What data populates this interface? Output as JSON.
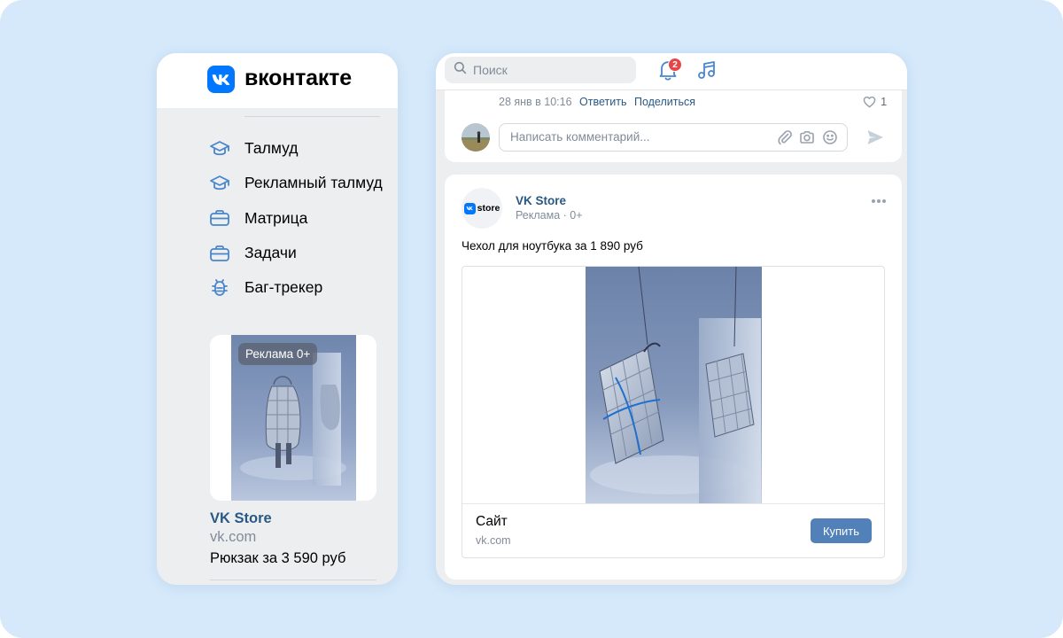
{
  "brand": {
    "logo_text": "вконтакте",
    "accent_color": "#0077ff",
    "link_color": "#2a5885",
    "background_color": "#d5e9fb"
  },
  "sidebar": {
    "items": [
      {
        "label": "Талмуд",
        "icon": "graduation-cap-icon"
      },
      {
        "label": "Рекламный талмуд",
        "icon": "graduation-cap-icon"
      },
      {
        "label": "Матрица",
        "icon": "briefcase-icon"
      },
      {
        "label": "Задачи",
        "icon": "briefcase-icon"
      },
      {
        "label": "Баг-трекер",
        "icon": "bug-icon"
      }
    ],
    "ad": {
      "badge": "Реклама 0+",
      "title": "VK Store",
      "url": "vk.com",
      "description": "Рюкзак за 3 590 руб"
    }
  },
  "topbar": {
    "search_placeholder": "Поиск",
    "notification_count": "2"
  },
  "prev_post": {
    "date": "28 янв в 10:16",
    "reply_label": "Ответить",
    "share_label": "Поделиться",
    "like_count": "1",
    "comment_placeholder": "Написать комментарий..."
  },
  "post": {
    "avatar_text": "store",
    "author": "VK Store",
    "subtitle": "Реклама · 0+",
    "text": "Чехол для ноутбука за 1 890 руб",
    "snippet": {
      "title": "Сайт",
      "url": "vk.com",
      "button_label": "Купить"
    }
  }
}
